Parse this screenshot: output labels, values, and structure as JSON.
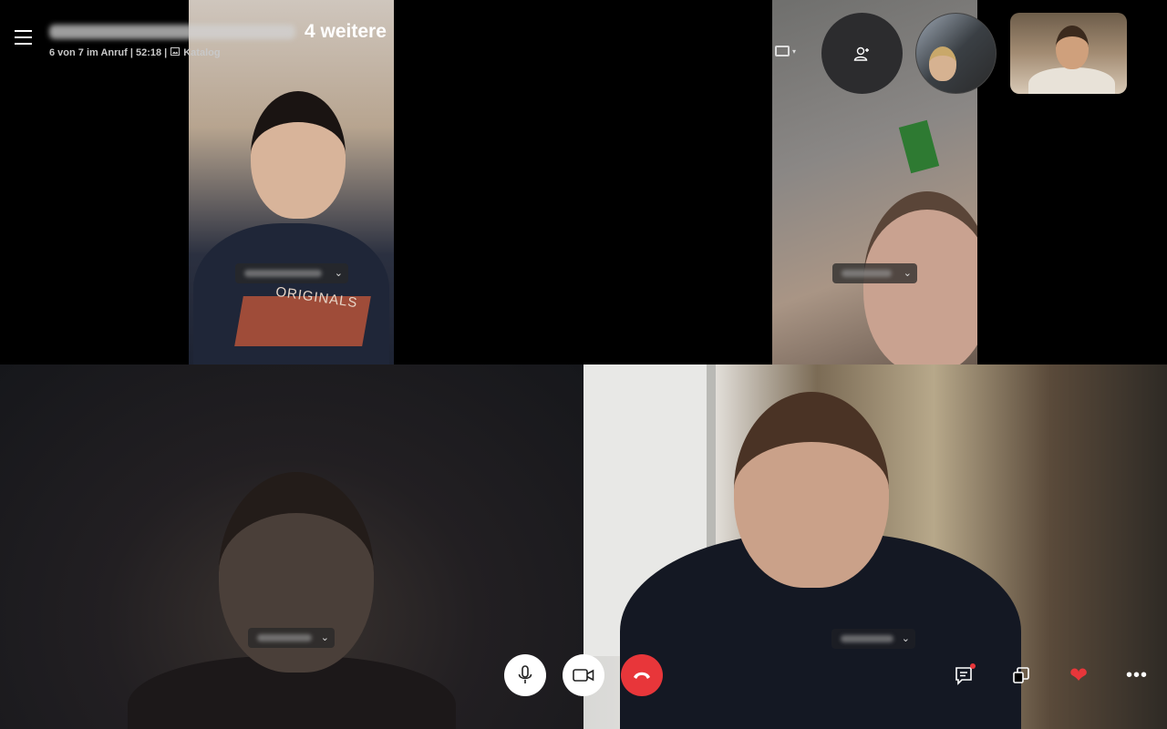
{
  "header": {
    "title_suffix": "4 weitere",
    "call_status": "6 von 7 im Anruf | 52:18 |",
    "katalog_label": "Katalog",
    "katalog_icon": "image-icon"
  },
  "top_controls": {
    "frame_icon": "crop-frame-icon",
    "add_person_icon": "add-person-icon"
  },
  "participants": [
    {
      "tile": "video-tile-top-left",
      "name_chevron": "⌄"
    },
    {
      "tile": "video-tile-top-right",
      "name_chevron": "⌄"
    },
    {
      "tile": "video-tile-bottom-left",
      "name_chevron": "⌄"
    },
    {
      "tile": "video-tile-bottom-right",
      "name_chevron": "⌄"
    }
  ],
  "tile_1_shirt_text": "ORIGINALS",
  "controls": {
    "mic_icon": "microphone-icon",
    "video_icon": "video-camera-icon",
    "hangup_icon": "hang-up-icon",
    "chat_icon": "chat-icon",
    "switch_icon": "switch-view-icon",
    "heart_icon": "heart-icon",
    "heart_glyph": "❤",
    "more_icon": "more-icon",
    "more_glyph": "•••"
  },
  "colors": {
    "hangup": "#e8363a",
    "heart": "#e8363a",
    "notification_dot": "#e8363a"
  }
}
